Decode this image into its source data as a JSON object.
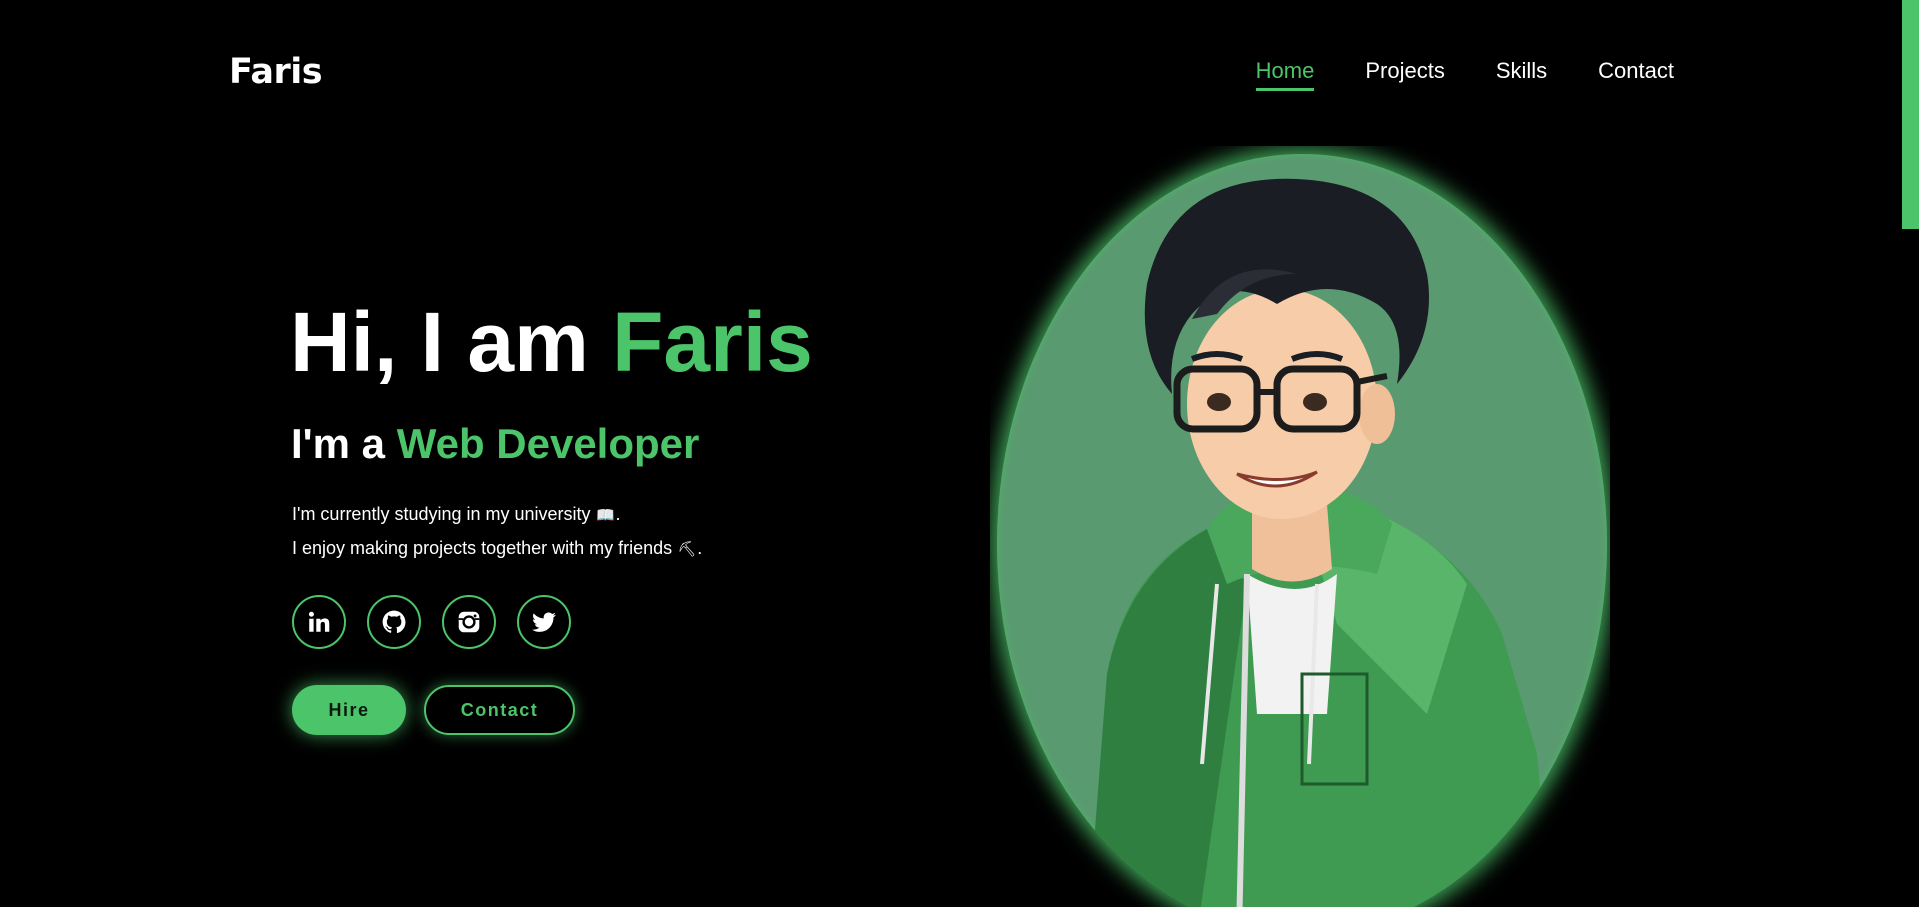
{
  "header": {
    "logo": "Faris",
    "nav": [
      {
        "label": "Home",
        "active": true
      },
      {
        "label": "Projects",
        "active": false
      },
      {
        "label": "Skills",
        "active": false
      },
      {
        "label": "Contact",
        "active": false
      }
    ]
  },
  "hero": {
    "title_prefix": "Hi, I am ",
    "title_name": "Faris",
    "subtitle_prefix": "I'm a ",
    "subtitle_role": "Web Developer",
    "desc_line1": "I'm currently studying in my university",
    "desc_line1_emoji": "📖",
    "desc_line2": "I enjoy making projects together with my friends",
    "desc_line2_emoji": "⛏",
    "period": "."
  },
  "socials": [
    {
      "name": "linkedin-icon"
    },
    {
      "name": "github-icon"
    },
    {
      "name": "instagram-icon"
    },
    {
      "name": "twitter-icon"
    }
  ],
  "buttons": {
    "hire": "Hire",
    "contact": "Contact"
  },
  "colors": {
    "accent": "#4cc46a",
    "background": "#000000",
    "text": "#ffffff",
    "portrait_bg": "#5a9a70"
  }
}
